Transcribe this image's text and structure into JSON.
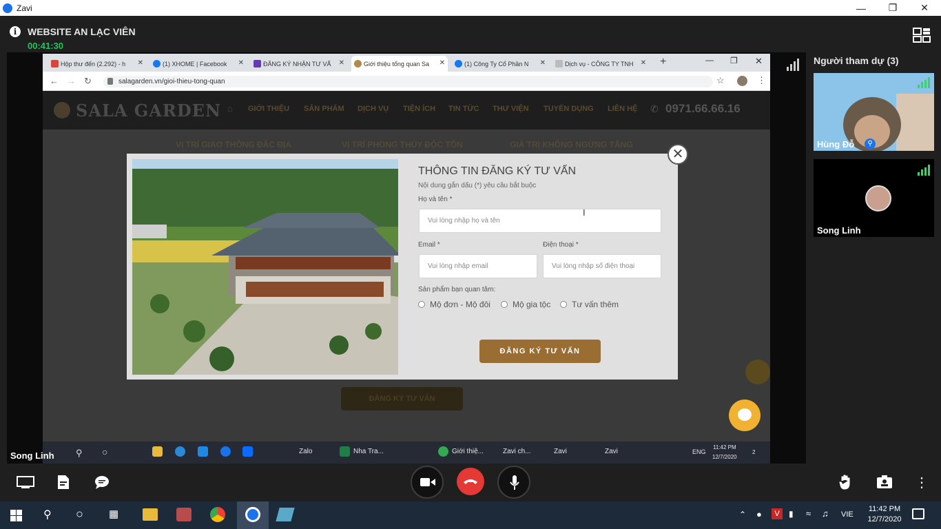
{
  "window": {
    "title": "Zavi"
  },
  "meeting": {
    "title": "WEBSITE AN LẠC VIÊN",
    "timer": "00:41:30",
    "presenter": "Song Linh"
  },
  "browser": {
    "tabs": [
      {
        "label": "Hộp thư đến (2.292) - h",
        "color": "#db4437"
      },
      {
        "label": "(1) XHOME | Facebook",
        "color": "#1877f2"
      },
      {
        "label": "ĐĂNG KÝ NHẬN TƯ VẤ",
        "color": "#673ab7"
      },
      {
        "label": "Giới thiệu tổng quan Sa",
        "color": "#b08a4a"
      },
      {
        "label": "(1) Công Ty Cổ Phần N",
        "color": "#1877f2"
      },
      {
        "label": "Dịch vụ - CÔNG TY TNH",
        "color": "#999999"
      }
    ],
    "url": "salagarden.vn/gioi-thieu-tong-quan"
  },
  "site": {
    "brand": "SALA GARDEN",
    "nav": [
      "GIỚI THIỆU",
      "SẢN PHẨM",
      "DỊCH VỤ",
      "TIỆN ÍCH",
      "TIN TỨC",
      "THƯ VIỆN",
      "TUYỂN DỤNG",
      "LIÊN HỆ"
    ],
    "phone": "0971.66.66.16",
    "subnav": [
      "VỊ TRÍ GIAO THÔNG ĐẮC ĐỊA",
      "VỊ TRÍ PHONG THỦY ĐỘC TÔN",
      "GIÁ TRỊ KHÔNG NGỪNG TĂNG"
    ],
    "background_button": "ĐĂNG KÝ TƯ VẤN"
  },
  "form": {
    "title": "THÔNG TIN ĐĂNG KÝ TƯ VẤN",
    "note": "Nội dung gắn dấu (*) yêu cầu bắt buộc",
    "name_label": "Họ và tên *",
    "name_placeholder": "Vui lòng nhập họ và tên",
    "email_label": "Email *",
    "email_placeholder": "Vui lòng nhập email",
    "phone_label": "Điện thoại *",
    "phone_placeholder": "Vui lòng nhập số điện thoại",
    "product_label": "Sản phẩm bạn quan tâm:",
    "options": [
      "Mộ đơn - Mộ đôi",
      "Mộ gia tộc",
      "Tư vấn thêm"
    ],
    "submit": "ĐĂNG KÝ TƯ VẤN"
  },
  "inner_taskbar": {
    "items": [
      "Zalo",
      "Nha Tra...",
      "Giới thiệ...",
      "Zavi ch...",
      "Zavi",
      "Zavi"
    ],
    "lang": "ENG",
    "time": "11:42 PM",
    "date": "12/7/2020",
    "notif_count": "2"
  },
  "participants": {
    "title": "Người tham dự (3)",
    "list": [
      {
        "name": "Hùng Đỗ"
      },
      {
        "name": "Song Linh"
      }
    ]
  },
  "taskbar": {
    "lang": "VIE",
    "time": "11:42 PM",
    "date": "12/7/2020"
  },
  "colors": {
    "accent": "#22c55e",
    "end_call": "#e53935",
    "submit": "#9a6d33"
  }
}
